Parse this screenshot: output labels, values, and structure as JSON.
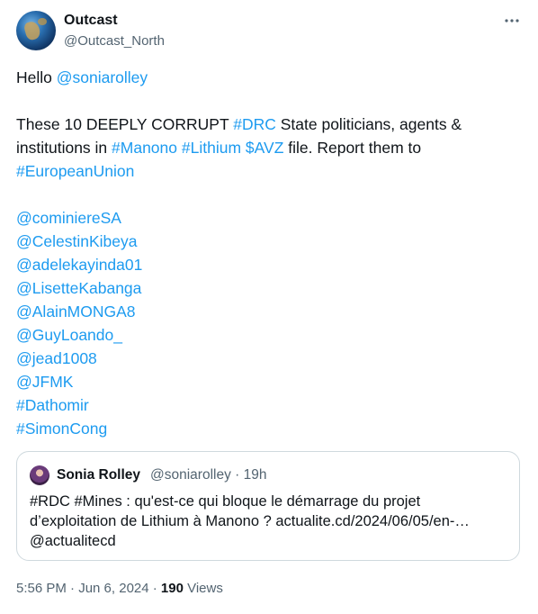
{
  "author": {
    "name": "Outcast",
    "handle": "@Outcast_North"
  },
  "more_label": "···",
  "tweet": {
    "greeting": {
      "text": "Hello ",
      "mention": "@soniarolley"
    },
    "statement": {
      "t1": "These 10 DEEPLY CORRUPT ",
      "h1": "#DRC",
      "t2": " State politicians, agents & institutions in ",
      "h2": "#Manono",
      "sp1": " ",
      "h3": "#Lithium",
      "sp2": " ",
      "c1": "$AVZ",
      "t3": " file. Report them to ",
      "h4": "#EuropeanUnion"
    },
    "mentions": [
      "@cominiereSA",
      "@CelestinKibeya",
      "@adelekayinda01",
      "@LisetteKabanga",
      "@AlainMONGA8",
      "@GuyLoando_",
      "@jead1008",
      "@JFMK",
      "#Dathomir",
      "#SimonCong"
    ]
  },
  "quote": {
    "name": "Sonia Rolley",
    "meta": "@soniarolley · 19h",
    "lines": [
      "#RDC #Mines : qu'est-ce qui bloque le démarrage du projet",
      "d’exploitation de Lithium à Manono ? actualite.cd/2024/06/05/en-…",
      "@actualitecd"
    ]
  },
  "footer": {
    "timestamp": "5:56 PM · Jun 6, 2024 · ",
    "views_count": "190",
    "views_label": " Views"
  },
  "colors": {
    "link": "#1d9bf0",
    "text": "#0f1419",
    "muted": "#536471",
    "border": "#cfd9de"
  }
}
